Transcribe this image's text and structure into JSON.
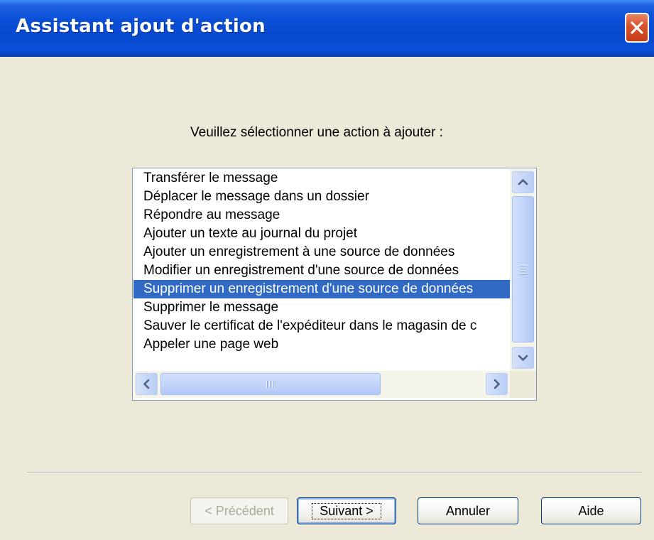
{
  "window": {
    "title": "Assistant ajout d'action",
    "close_icon": "close-x-icon"
  },
  "prompt": "Veuillez sélectionner une action à ajouter :",
  "actions": {
    "selected_index": 6,
    "items": [
      "Transférer le message",
      "Déplacer le message dans un dossier",
      "Répondre au message",
      "Ajouter un texte au journal du projet",
      "Ajouter un enregistrement à une source de données",
      "Modifier un enregistrement d'une source de données",
      "Supprimer un enregistrement d'une source de données",
      "Supprimer le message",
      "Sauver le certificat de l'expéditeur dans le magasin de c",
      "Appeler une page web"
    ]
  },
  "buttons": {
    "previous": "< Précédent",
    "next": "Suivant >",
    "cancel": "Annuler",
    "help": "Aide"
  },
  "colors": {
    "titlebar": "#0a4fd6",
    "selection": "#316ac5",
    "dialog_bg": "#ece9d8",
    "close_button": "#d9532e"
  }
}
